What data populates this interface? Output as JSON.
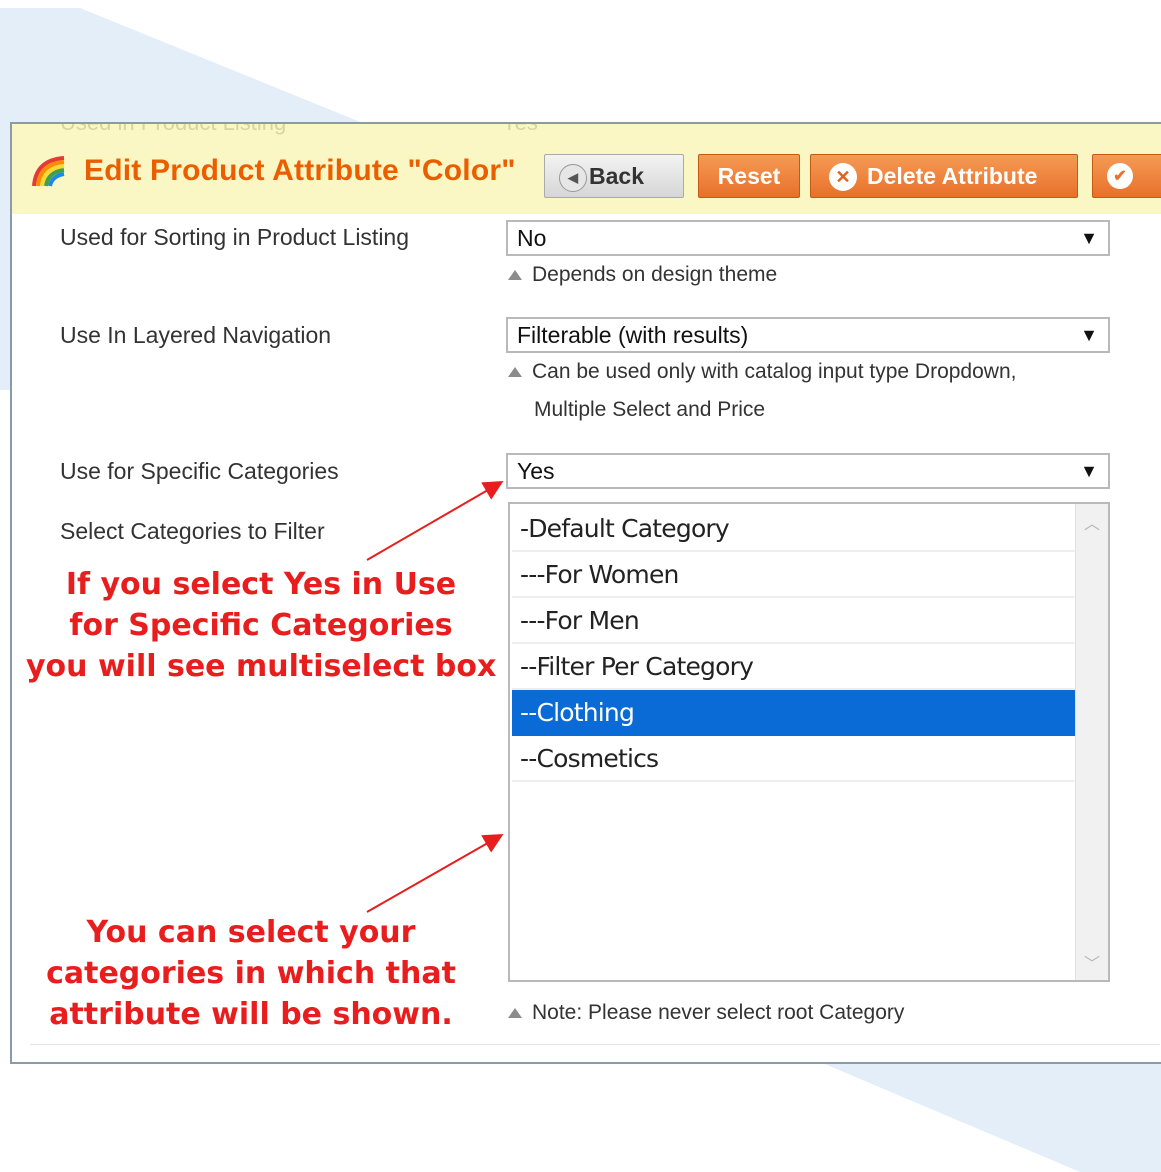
{
  "header": {
    "title": "Edit Product Attribute \"Color\"",
    "ghost_text_left": "Used in Product Listing",
    "ghost_text_right": "Yes",
    "buttons": {
      "back": "Back",
      "reset": "Reset",
      "delete": "Delete Attribute"
    },
    "accent_color": "#eb5e00",
    "background_color": "#fbf7c4"
  },
  "fields": {
    "sorting": {
      "label": "Used for Sorting in Product Listing",
      "value": "No",
      "note": "Depends on design theme"
    },
    "layered": {
      "label": "Use In Layered Navigation",
      "value": "Filterable (with results)",
      "note_line1": "Can be used only with catalog input type Dropdown,",
      "note_line2": "Multiple Select and Price"
    },
    "specific": {
      "label": "Use for Specific Categories",
      "value": "Yes"
    },
    "categories": {
      "label": "Select Categories to Filter",
      "options": [
        {
          "label": "-Default Category",
          "selected": false
        },
        {
          "label": "---For Women",
          "selected": false
        },
        {
          "label": "---For Men",
          "selected": false
        },
        {
          "label": "--Filter Per Category",
          "selected": false
        },
        {
          "label": "--Clothing",
          "selected": true
        },
        {
          "label": "--Cosmetics",
          "selected": false
        }
      ],
      "note": "Note: Please never select root Category"
    }
  },
  "annotations": {
    "first": {
      "line1": "If you select Yes in Use",
      "line2": "for Specific Categories",
      "line3": "you will see multiselect box"
    },
    "second": {
      "line1": "You can select your",
      "line2": "categories in which that",
      "line3": "attribute will be shown."
    },
    "color": "#e81e1e"
  },
  "icons": {
    "title": "rainbow-icon",
    "back": "back-arrow-icon",
    "delete": "close-circle-icon",
    "save": "check-icon",
    "note": "triangle-up-icon"
  },
  "selection_color": "#0a6ad6"
}
